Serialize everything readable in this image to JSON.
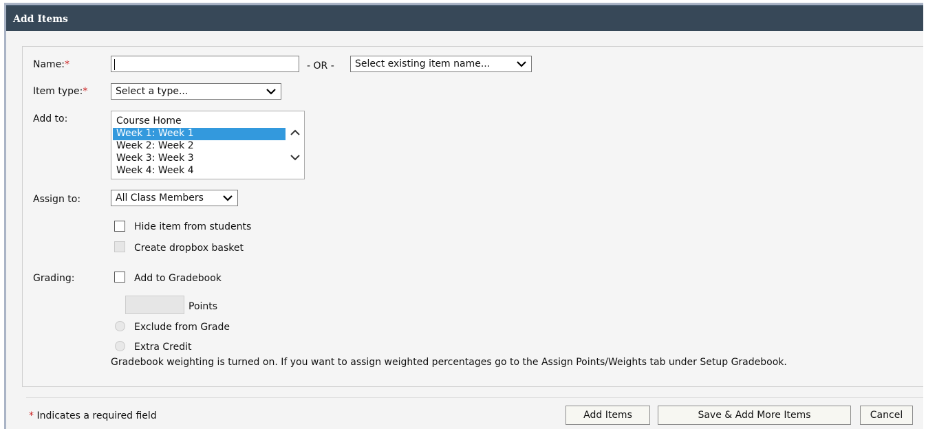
{
  "dialog": {
    "title": "Add Items"
  },
  "form": {
    "name_label": "Name:",
    "required_marker": "*",
    "name_value": "",
    "or_text": "- OR -",
    "existing_select": "Select existing item name...",
    "item_type_label": "Item type:",
    "item_type_select": "Select a type...",
    "add_to_label": "Add to:",
    "add_to_options": [
      "Course Home",
      "Week 1: Week 1",
      "Week 2: Week 2",
      "Week 3: Week 3",
      "Week 4: Week 4"
    ],
    "add_to_selected": "Week 1: Week 1",
    "assign_to_label": "Assign to:",
    "assign_to_select": "All Class Members",
    "hide_item_label": "Hide item from students",
    "hide_item_checked": false,
    "dropbox_label": "Create dropbox basket",
    "dropbox_enabled": false,
    "grading_label": "Grading:",
    "gradebook_label": "Add to Gradebook",
    "gradebook_checked": false,
    "points_label": "Points",
    "points_value": "",
    "exclude_label": "Exclude from Grade",
    "extra_credit_label": "Extra Credit",
    "weighting_note": "Gradebook weighting is turned on. If you want to assign weighted percentages go to the Assign Points/Weights tab under Setup Gradebook."
  },
  "footer": {
    "required_marker": "*",
    "required_note": "Indicates a required field",
    "add_items_button": "Add Items",
    "save_more_button": "Save & Add More Items",
    "cancel_button": "Cancel"
  },
  "colors": {
    "titlebar": "#374858",
    "required": "#cc2222",
    "selection": "#3399dd"
  }
}
